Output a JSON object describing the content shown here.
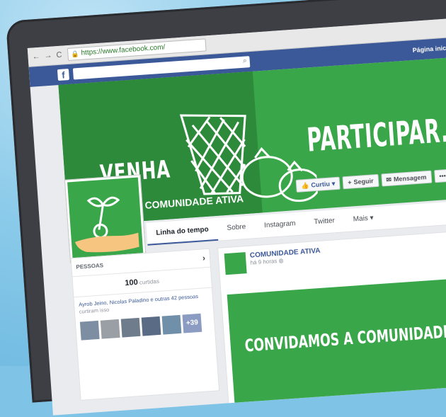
{
  "browser": {
    "url": "https://www.facebook.com/",
    "back": "←",
    "forward": "→",
    "reload": "C"
  },
  "facebook": {
    "logo": "f",
    "home": "Página inicial"
  },
  "cover": {
    "left_text": "VENHA",
    "right_text": "PARTICIPAR."
  },
  "page": {
    "name": "COMUNIDADE ATIVA",
    "buttons": {
      "liked": "Curtiu",
      "follow": "Seguir",
      "message": "Mensagem",
      "more": "•••"
    }
  },
  "tabs": [
    {
      "label": "Linha do tempo"
    },
    {
      "label": "Sobre"
    },
    {
      "label": "Instagram"
    },
    {
      "label": "Twitter"
    },
    {
      "label": "Mais"
    }
  ],
  "people": {
    "header": "PESSOAS",
    "likes_count": "100",
    "likes_label": "curtidas",
    "friends_text": "Ayrob Jeino, Nicolas Paladino e outras 42 pessoas",
    "friends_sub": "curtiram isso",
    "more_count": "+39"
  },
  "post": {
    "author": "COMUNIDADE ATIVA",
    "time": "há 9 horas",
    "caption": "CONVIDAMOS A COMUNIDADE"
  },
  "colors": {
    "fb_blue": "#3b5998",
    "cover_green": "#3aa64a",
    "cover_dark_green": "#2d8a3a",
    "monitor": "#3d3f45"
  }
}
